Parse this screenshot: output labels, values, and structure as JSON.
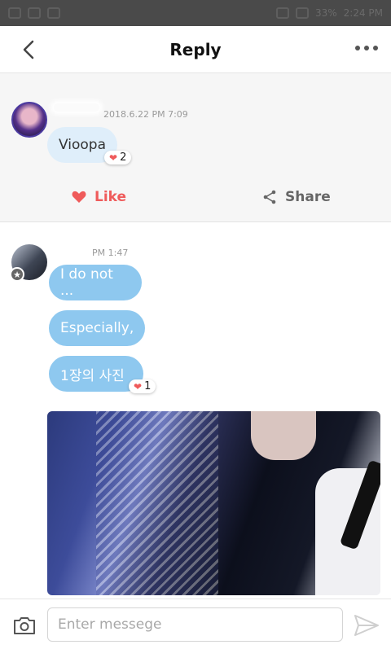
{
  "status_bar": {
    "battery": "33%",
    "time": "2:24 PM"
  },
  "header": {
    "title": "Reply"
  },
  "post": {
    "timestamp": "2018.6.22 PM 7:09",
    "message": "Vioopa",
    "like_count": "2",
    "like_label": "Like",
    "share_label": "Share"
  },
  "replies": {
    "timestamp": "PM 1:47",
    "messages": [
      "I do not ...",
      "Especially,",
      "1장의 사진"
    ],
    "like_count": "1"
  },
  "composer": {
    "placeholder": "Enter messege"
  },
  "colors": {
    "like": "#ef5b5b",
    "bubble_blue": "#8ec8ef",
    "bubble_light": "#dfeefa"
  }
}
